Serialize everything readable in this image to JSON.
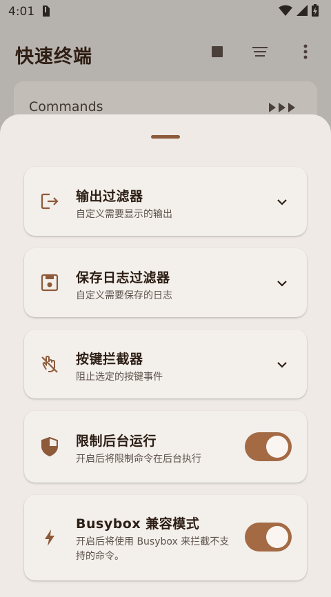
{
  "status_bar": {
    "time": "4:01"
  },
  "app_bar": {
    "title": "快速终端"
  },
  "commands_card": {
    "label": "Commands"
  },
  "sheet": {
    "items": [
      {
        "title": "输出过滤器",
        "subtitle": "自定义需要显示的输出",
        "icon": "output-export-icon",
        "control": "expand"
      },
      {
        "title": "保存日志过滤器",
        "subtitle": "自定义需要保存的日志",
        "icon": "save-floppy-icon",
        "control": "expand"
      },
      {
        "title": "按键拦截器",
        "subtitle": "阻止选定的按键事件",
        "icon": "touch-off-icon",
        "control": "expand"
      },
      {
        "title": "限制后台运行",
        "subtitle": "开启后将限制命令在后台执行",
        "icon": "shield-icon",
        "control": "toggle",
        "enabled": true
      },
      {
        "title": "Busybox 兼容模式",
        "subtitle": "开启后将使用 Busybox 来拦截不支持的命令。",
        "icon": "bolt-icon",
        "control": "toggle",
        "enabled": true
      }
    ]
  },
  "colors": {
    "accent": "#a36a44",
    "icon": "#8d5a3a",
    "sheet_bg": "#efeae6",
    "scrim": "#b6b2ae"
  }
}
